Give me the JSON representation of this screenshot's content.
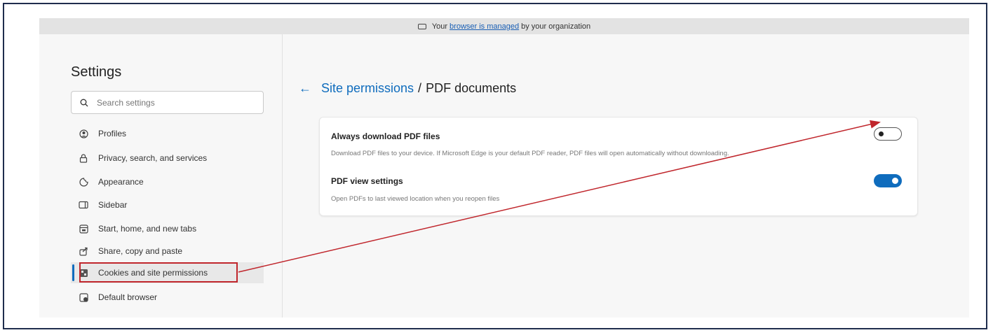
{
  "infobar": {
    "prefix": "Your",
    "link": "browser is managed",
    "suffix": "by your organization"
  },
  "sidebar": {
    "title": "Settings",
    "search_placeholder": "Search settings",
    "items": [
      {
        "label": "Profiles",
        "icon": "profile-icon"
      },
      {
        "label": "Privacy, search, and services",
        "icon": "lock-icon"
      },
      {
        "label": "Appearance",
        "icon": "appearance-icon"
      },
      {
        "label": "Sidebar",
        "icon": "sidebar-icon"
      },
      {
        "label": "Start, home, and new tabs",
        "icon": "home-tabs-icon"
      },
      {
        "label": "Share, copy and paste",
        "icon": "share-icon"
      },
      {
        "label": "Cookies and site permissions",
        "icon": "cookies-icon",
        "active": true
      },
      {
        "label": "Default browser",
        "icon": "default-browser-icon"
      }
    ]
  },
  "main": {
    "breadcrumb": {
      "link": "Site permissions",
      "separator": "/",
      "current": "PDF documents"
    },
    "settings": [
      {
        "title": "Always download PDF files",
        "description": "Download PDF files to your device. If Microsoft Edge is your default PDF reader, PDF files will open automatically without downloading.",
        "enabled": false
      },
      {
        "title": "PDF view settings",
        "description": "Open PDFs to last viewed location when you reopen files",
        "enabled": true
      }
    ]
  },
  "colors": {
    "accent": "#0f6cbd",
    "annotation": "#c0262c"
  }
}
